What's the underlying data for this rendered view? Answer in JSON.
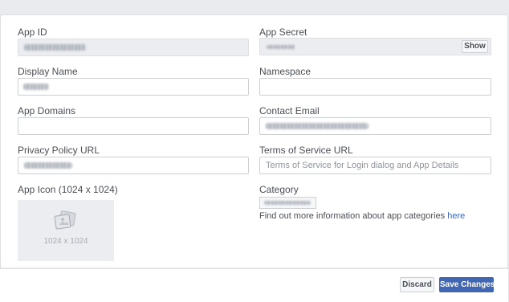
{
  "form": {
    "app_id": {
      "label": "App ID"
    },
    "app_secret": {
      "label": "App Secret",
      "show_label": "Show"
    },
    "display_name": {
      "label": "Display Name"
    },
    "namespace": {
      "label": "Namespace"
    },
    "app_domains": {
      "label": "App Domains"
    },
    "contact_email": {
      "label": "Contact Email"
    },
    "privacy_policy_url": {
      "label": "Privacy Policy URL"
    },
    "terms_of_service_url": {
      "label": "Terms of Service URL",
      "placeholder": "Terms of Service for Login dialog and App Details"
    },
    "app_icon": {
      "label": "App Icon (1024 x 1024)",
      "size_text": "1024 x 1024"
    },
    "category": {
      "label": "Category",
      "info_text": "Find out more information about app categories ",
      "info_link": "here"
    }
  },
  "footer": {
    "discard_label": "Discard",
    "save_label": "Save Changes"
  }
}
